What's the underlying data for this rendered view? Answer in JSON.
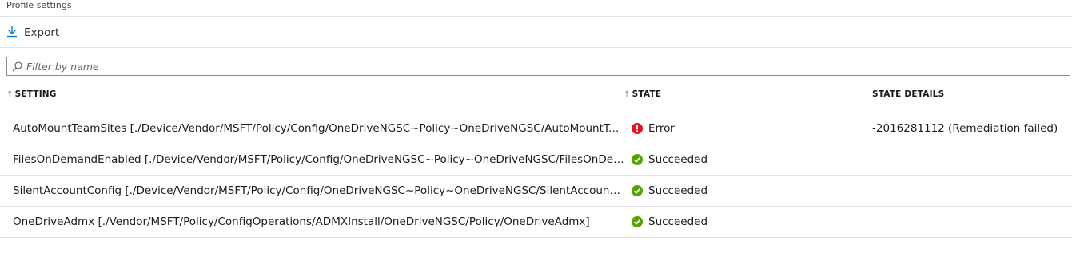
{
  "breadcrumb": "Profile settings",
  "toolbar": {
    "export_label": "Export"
  },
  "filter": {
    "placeholder": "Filter by name",
    "value": ""
  },
  "columns": {
    "setting": "SETTING",
    "state": "STATE",
    "state_details": "STATE DETAILS"
  },
  "colors": {
    "error": "#e81123",
    "success": "#57a300",
    "accent": "#0078d4"
  },
  "rows": [
    {
      "setting": "AutoMountTeamSites [./Device/Vendor/MSFT/Policy/Config/OneDriveNGSC~Policy~OneDriveNGSC/AutoMountTe...",
      "state": "Error",
      "state_icon": "error-icon",
      "details": "-2016281112 (Remediation failed)"
    },
    {
      "setting": "FilesOnDemandEnabled [./Device/Vendor/MSFT/Policy/Config/OneDriveNGSC~Policy~OneDriveNGSC/FilesOnDem...",
      "state": "Succeeded",
      "state_icon": "success-icon",
      "details": ""
    },
    {
      "setting": "SilentAccountConfig [./Device/Vendor/MSFT/Policy/Config/OneDriveNGSC~Policy~OneDriveNGSC/SilentAccountC...",
      "state": "Succeeded",
      "state_icon": "success-icon",
      "details": ""
    },
    {
      "setting": "OneDriveAdmx [./Vendor/MSFT/Policy/ConfigOperations/ADMXInstall/OneDriveNGSC/Policy/OneDriveAdmx]",
      "state": "Succeeded",
      "state_icon": "success-icon",
      "details": ""
    }
  ]
}
